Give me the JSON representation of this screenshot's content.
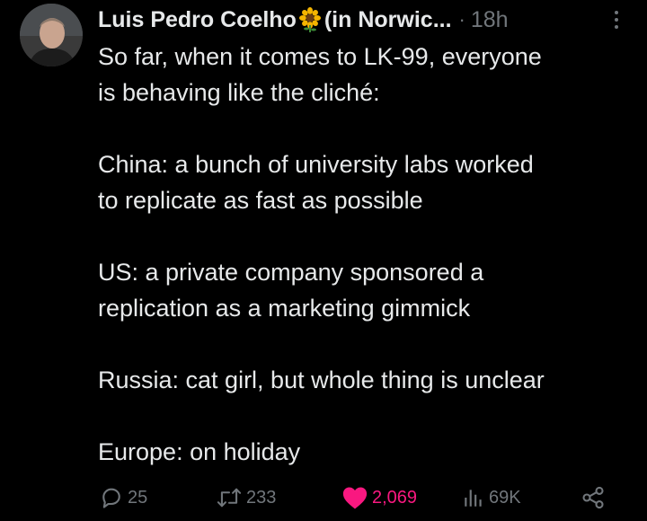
{
  "author": {
    "display_name": "Luis Pedro Coelho",
    "name_emoji": "sunflower-emoji",
    "name_suffix": "(in Norwic...",
    "time": "18h"
  },
  "post": {
    "paragraphs": [
      [
        "So far, when it comes to LK-99, everyone",
        "is behaving like the cliché:"
      ],
      [
        "China: a bunch of university labs worked",
        "to replicate as fast as possible"
      ],
      [
        "US: a private company sponsored a",
        "replication as a marketing gimmick"
      ],
      [
        "Russia: cat girl, but whole thing is unclear"
      ],
      [
        "Europe: on holiday"
      ]
    ]
  },
  "actions": {
    "reply_count": "25",
    "repost_count": "233",
    "like_count": "2,069",
    "views_count": "69K"
  },
  "icons": {
    "reply": "reply-icon",
    "repost": "repost-icon",
    "like": "heart-icon",
    "views": "views-icon",
    "share": "share-icon",
    "more": "more-icon"
  },
  "colors": {
    "background": "#000000",
    "text": "#e7e9ea",
    "muted": "#71767b",
    "like": "#f91880"
  }
}
